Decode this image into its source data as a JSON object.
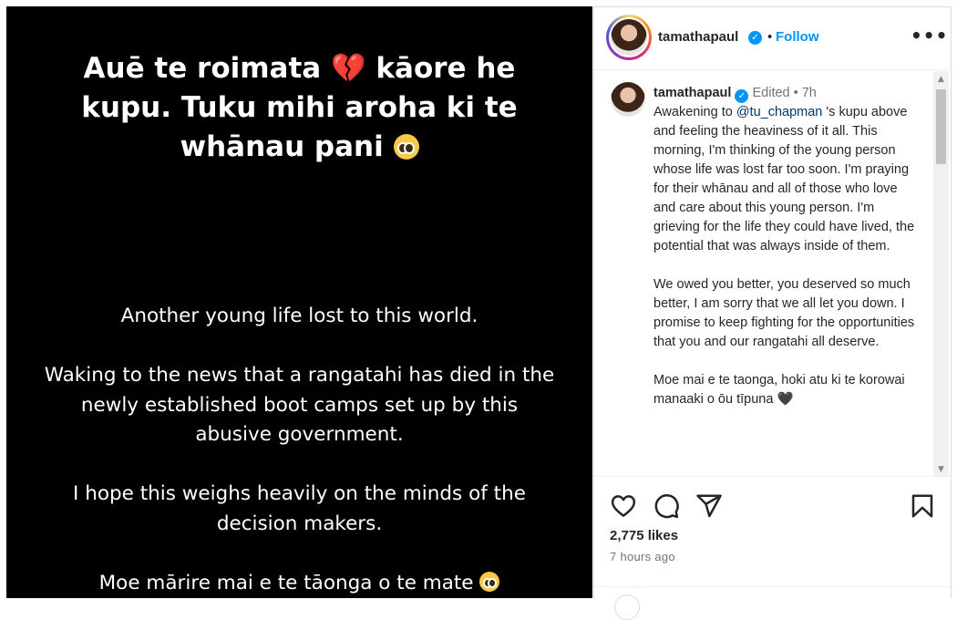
{
  "media": {
    "headline_line1": "Auē te roimata",
    "headline_heart_emoji": "💔",
    "headline_line1b": "kāore he",
    "headline_line2": "kupu. Tuku mihi aroha ki te",
    "headline_line3": "whānau pani",
    "body_p1": "Another young life lost to this world.",
    "body_p2": "Waking to the news that a rangatahi has died in the newly established boot camps set up by this abusive government.",
    "body_p3": "I hope this weighs heavily on the minds of the decision makers.",
    "body_p4": "Moe mārire mai e te tāonga o te mate"
  },
  "header": {
    "username": "tamathapaul",
    "verified_glyph": "✓",
    "separator": "•",
    "follow_label": "Follow",
    "more_glyph": "•••"
  },
  "caption": {
    "username": "tamathapaul",
    "verified_glyph": "✓",
    "meta": "Edited • 7h",
    "text_before_mention": "Awakening to",
    "mention": "@tu_chapman",
    "text_after_mention": "'s kupu above and feeling the heaviness of it all. This morning, I'm thinking of the young person whose life was lost far too soon. I'm praying for their whānau and all of those who love and care about this young person. I'm grieving for the life they could have lived, the potential that was always inside of them.",
    "para2": "We owed you better, you deserved so much better, I am sorry that we all let you down. I promise to keep fighting for the opportunities that you and our rangatahi all deserve.",
    "para3": "Moe mai e te taonga, hoki atu ki te korowai manaaki o ōu tīpuna",
    "para3_emoji": "🖤"
  },
  "scrollbar": {
    "up_glyph": "▲",
    "down_glyph": "▼"
  },
  "actions": {
    "icons": [
      "heart-icon",
      "comment-icon",
      "share-icon",
      "bookmark-icon"
    ],
    "likes": "2,775 likes",
    "time_ago": "7 hours ago"
  },
  "colors": {
    "accent": "#0095f6",
    "media_bg": "#000000",
    "text": "#262626",
    "muted": "#737373"
  }
}
